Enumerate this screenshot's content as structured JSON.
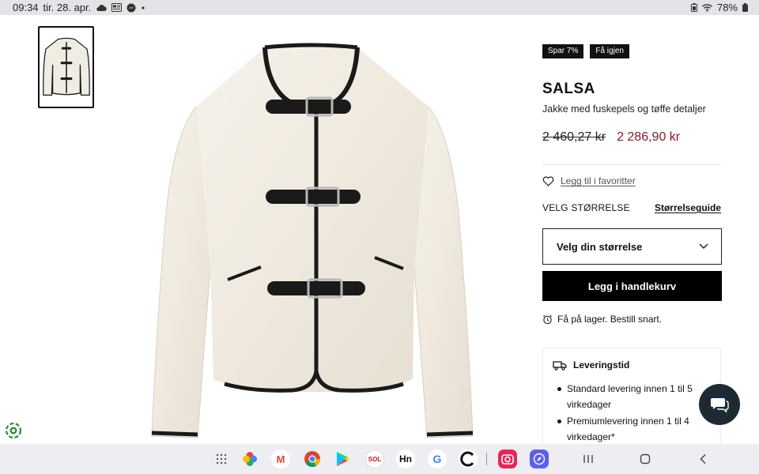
{
  "status_bar": {
    "time": "09:34",
    "date": "tir. 28. apr.",
    "battery": "78%"
  },
  "product": {
    "badges": [
      "Spar 7%",
      "Få igjen"
    ],
    "brand": "SALSA",
    "subtitle": "Jakke med fuskepels og tøffe detaljer",
    "old_price": "2 460,27 kr",
    "new_price": "2 286,90 kr",
    "favorite_label": "Legg til i favoritter",
    "size_heading": "VELG STØRRELSE",
    "size_guide": "Størrelseguide",
    "size_select_placeholder": "Velg din størrelse",
    "add_to_cart": "Legg i handlekurv",
    "stock_text": "Få på lager. Bestill snart."
  },
  "delivery": {
    "title": "Leveringstid",
    "items": [
      "Standard levering innen 1 til 5 virkedager",
      "Premiumlevering innen 1 til 4 virkedager*"
    ]
  },
  "colors": {
    "sale_price": "#8b1a2b",
    "button_bg": "#000000",
    "chat_bg": "#1d2a33",
    "jacket": "#f1ece2",
    "trim": "#1a1a1a"
  },
  "taskbar": {
    "apps": [
      "app-drawer-icon",
      "photos-icon",
      "gmail-icon",
      "chrome-icon",
      "play-store-icon",
      "sol-icon",
      "hn-icon",
      "google-icon",
      "c-icon",
      "camera-icon",
      "compass-icon"
    ],
    "nav": [
      "recents-icon",
      "home-icon",
      "back-icon"
    ],
    "sol_label": "SOL",
    "hn_label": "Hn",
    "g_label": "G",
    "m_label": "M"
  }
}
